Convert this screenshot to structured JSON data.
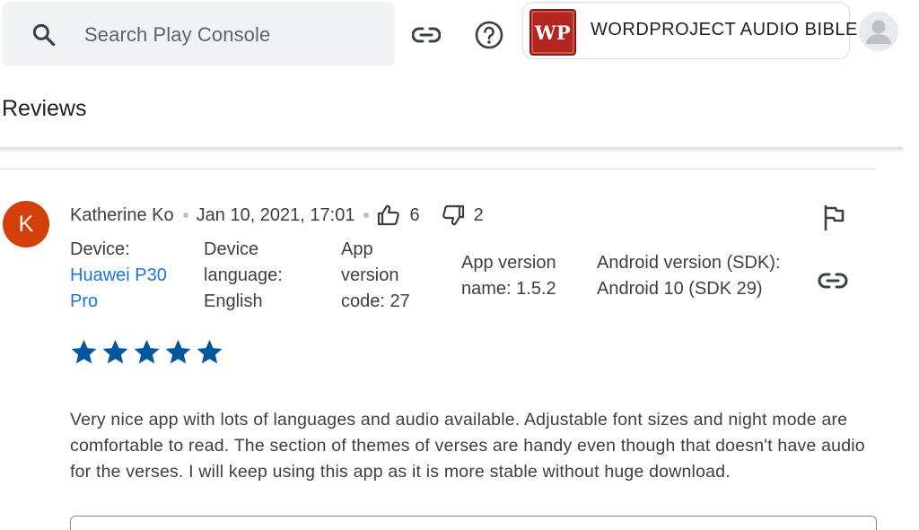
{
  "search": {
    "placeholder": "Search Play Console",
    "icon": "search-icon"
  },
  "toolbar": {
    "link_icon": "link-icon",
    "help_icon": "help-icon"
  },
  "app": {
    "logo_text": "WP",
    "name": "WORDPROJECT AUDIO BIBLE",
    "logo_color": "#b3261e"
  },
  "account": {
    "icon": "account-avatar"
  },
  "page": {
    "title": "Reviews"
  },
  "review": {
    "avatar_letter": "K",
    "avatar_color": "#d33f08",
    "author": "Katherine Ko",
    "date": "Jan 10, 2021, 17:01",
    "thumbs_up": "6",
    "thumbs_down": "2",
    "device_label": "Device:",
    "device_value": "Huawei P30 Pro",
    "language_label": "Device language:",
    "language_value": "English",
    "version_code_label": "App version code:",
    "version_code_value": "27",
    "version_name_label": "App version name:",
    "version_name_value": "1.5.2",
    "android_label": "Android version (SDK):",
    "android_value": "Android 10 (SDK 29)",
    "rating": 5,
    "rating_max": 5,
    "star_color": "#01579b",
    "text": "Very nice app with lots of languages and audio available. Adjustable font sizes and night mode are comfortable to read. The section of themes of verses are handy even though that doesn't have audio for the verses. I will keep using this app as it is more stable without huge download."
  }
}
